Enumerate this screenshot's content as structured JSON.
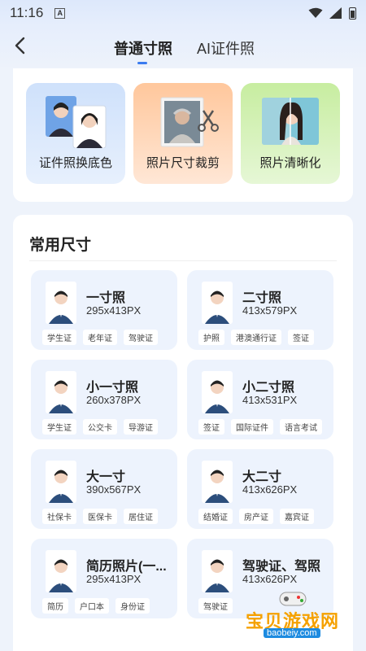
{
  "status_bar": {
    "time": "11:16",
    "a_label": "A"
  },
  "header": {
    "tab_normal": "普通寸照",
    "tab_ai": "AI证件照"
  },
  "features": [
    {
      "label": "证件照换底色",
      "icon": "id-photo-icon"
    },
    {
      "label": "照片尺寸裁剪",
      "icon": "crop-scissors-icon"
    },
    {
      "label": "照片清晰化",
      "icon": "enhance-icon"
    }
  ],
  "section_title": "常用尺寸",
  "sizes": [
    {
      "name": "一寸照",
      "px": "295x413PX",
      "tags": [
        "学生证",
        "老年证",
        "驾驶证"
      ]
    },
    {
      "name": "二寸照",
      "px": "413x579PX",
      "tags": [
        "护照",
        "港澳通行证",
        "签证"
      ]
    },
    {
      "name": "小一寸照",
      "px": "260x378PX",
      "tags": [
        "学生证",
        "公交卡",
        "导游证"
      ]
    },
    {
      "name": "小二寸照",
      "px": "413x531PX",
      "tags": [
        "签证",
        "国际证件",
        "语言考试"
      ]
    },
    {
      "name": "大一寸",
      "px": "390x567PX",
      "tags": [
        "社保卡",
        "医保卡",
        "居住证"
      ]
    },
    {
      "name": "大二寸",
      "px": "413x626PX",
      "tags": [
        "结婚证",
        "房产证",
        "嘉宾证"
      ]
    },
    {
      "name": "简历照片(一...",
      "px": "295x413PX",
      "tags": [
        "简历",
        "户口本",
        "身份证"
      ]
    },
    {
      "name": "驾驶证、驾照",
      "px": "413x626PX",
      "tags": [
        "驾驶证",
        "",
        ""
      ]
    }
  ],
  "watermark": {
    "text": "宝贝游戏网",
    "url": "baobeiy.com"
  }
}
